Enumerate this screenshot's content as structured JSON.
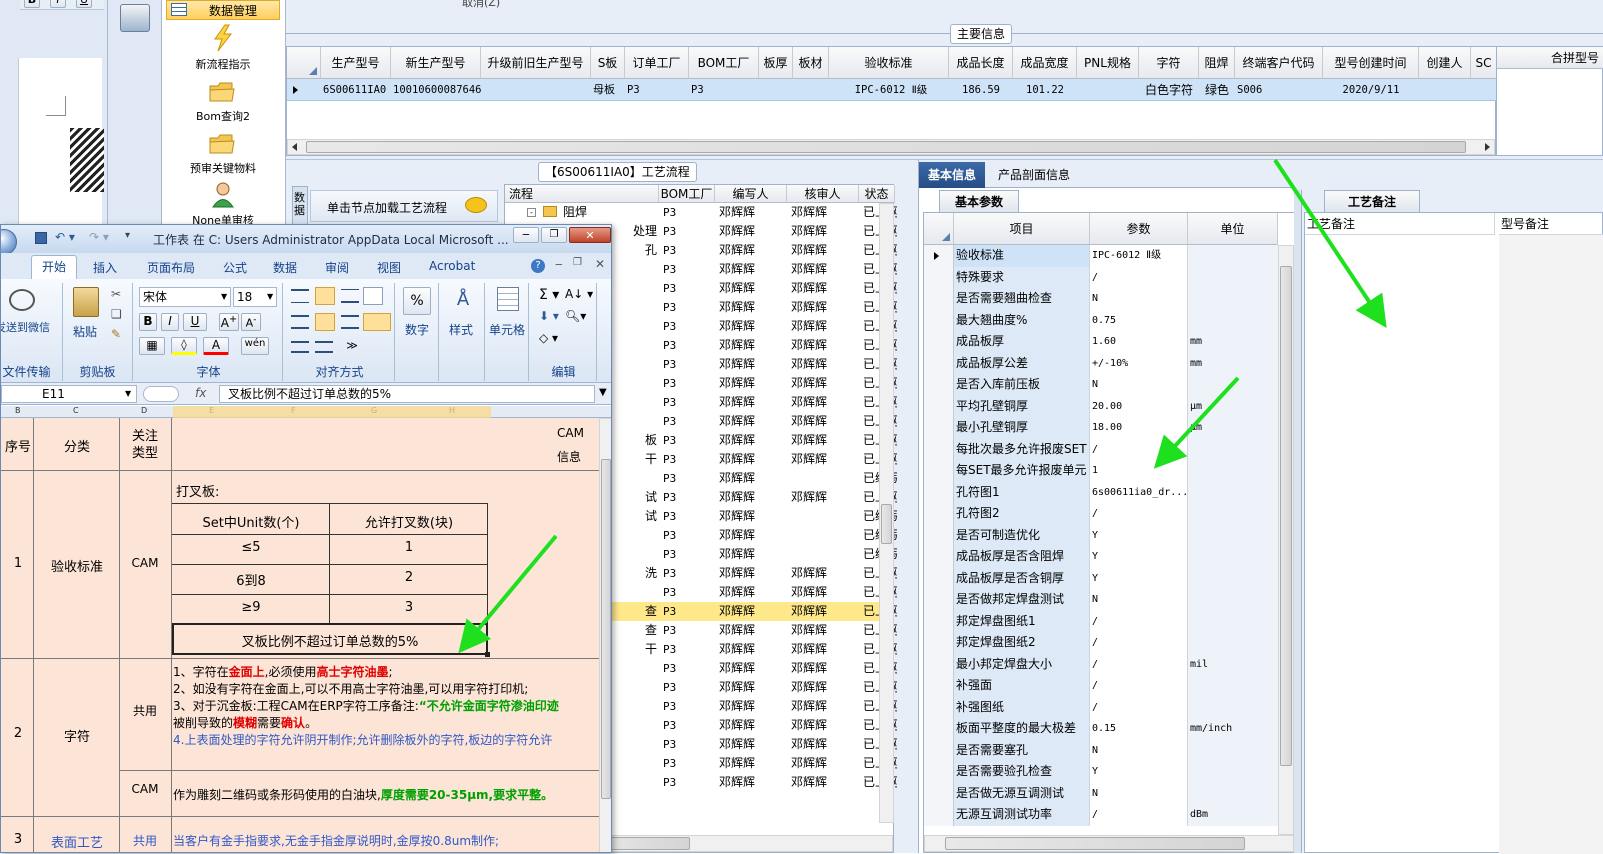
{
  "word_bg": {
    "fmt": [
      "B",
      "I",
      "U"
    ]
  },
  "launcher": {
    "items": [
      {
        "label": "数据管理",
        "icon": "table-icon"
      },
      {
        "label": "新流程指示",
        "icon": "lightning-icon"
      },
      {
        "label": "Bom查询2",
        "icon": "folder-icon"
      },
      {
        "label": "预审关键物料",
        "icon": "folder-icon"
      },
      {
        "label": "None单审核",
        "icon": "user-icon"
      }
    ]
  },
  "top_panel": {
    "cancel_label": "取消(Z)",
    "section_title": "主要信息",
    "merge_label": "合拼型号",
    "columns": [
      "生产型号",
      "新生产型号",
      "升级前旧生产型号",
      "S板",
      "订单工厂",
      "BOM工厂",
      "板厚",
      "板材",
      "验收标准",
      "成品长度",
      "成品宽度",
      "PNL规格",
      "字符",
      "阻焊",
      "终端客户代码",
      "型号创建时间",
      "创建人",
      "SC"
    ],
    "row": [
      "6S00611IA0",
      "10010600087646",
      "",
      "母板",
      "P3",
      "P3",
      "",
      "",
      "IPC-6012 Ⅱ级",
      "186.59",
      "101.22",
      "",
      "白色字符",
      "绿色",
      "S006",
      "2020/9/11",
      "",
      ""
    ]
  },
  "flow": {
    "title": "【6S00611IA0】工艺流程",
    "hint": "单击节点加载工艺流程",
    "side_tab": "数据",
    "columns": [
      "流程",
      "BOM工厂",
      "编写人",
      "核审人",
      "状态"
    ],
    "rows": [
      {
        "name": "阻焊",
        "tree": true,
        "bom": "P3",
        "w": "邓辉辉",
        "r": "邓辉辉",
        "s": "已上网"
      },
      {
        "name": "处理",
        "bom": "P3",
        "w": "邓辉辉",
        "r": "邓辉辉",
        "s": "已上网"
      },
      {
        "name": "孔",
        "bom": "P3",
        "w": "邓辉辉",
        "r": "邓辉辉",
        "s": "已上网"
      },
      {
        "name": "",
        "bom": "P3",
        "w": "邓辉辉",
        "r": "邓辉辉",
        "s": "已上网"
      },
      {
        "name": "",
        "bom": "P3",
        "w": "邓辉辉",
        "r": "邓辉辉",
        "s": "已上网"
      },
      {
        "name": "",
        "bom": "P3",
        "w": "邓辉辉",
        "r": "邓辉辉",
        "s": "已上网"
      },
      {
        "name": "",
        "bom": "P3",
        "w": "邓辉辉",
        "r": "邓辉辉",
        "s": "已上网"
      },
      {
        "name": "",
        "bom": "P3",
        "w": "邓辉辉",
        "r": "邓辉辉",
        "s": "已上网"
      },
      {
        "name": "",
        "bom": "P3",
        "w": "邓辉辉",
        "r": "邓辉辉",
        "s": "已上网"
      },
      {
        "name": "",
        "bom": "P3",
        "w": "邓辉辉",
        "r": "邓辉辉",
        "s": "已上网"
      },
      {
        "name": "",
        "bom": "P3",
        "w": "邓辉辉",
        "r": "邓辉辉",
        "s": "已上网"
      },
      {
        "name": "",
        "bom": "P3",
        "w": "邓辉辉",
        "r": "邓辉辉",
        "s": "已上网"
      },
      {
        "name": "板",
        "bom": "P3",
        "w": "邓辉辉",
        "r": "邓辉辉",
        "s": "已上网"
      },
      {
        "name": "干",
        "bom": "P3",
        "w": "邓辉辉",
        "r": "邓辉辉",
        "s": "已上网"
      },
      {
        "name": "",
        "bom": "P3",
        "w": "邓辉辉",
        "r": "",
        "s": "已编写"
      },
      {
        "name": "试",
        "bom": "P3",
        "w": "邓辉辉",
        "r": "邓辉辉",
        "s": "已上网"
      },
      {
        "name": "试",
        "bom": "P3",
        "w": "邓辉辉",
        "r": "",
        "s": "已编写"
      },
      {
        "name": "",
        "bom": "P3",
        "w": "邓辉辉",
        "r": "",
        "s": "已编写"
      },
      {
        "name": "",
        "bom": "P3",
        "w": "邓辉辉",
        "r": "",
        "s": "已编写"
      },
      {
        "name": "洗",
        "bom": "P3",
        "w": "邓辉辉",
        "r": "邓辉辉",
        "s": "已上网"
      },
      {
        "name": "",
        "bom": "P3",
        "w": "邓辉辉",
        "r": "邓辉辉",
        "s": "已上网"
      },
      {
        "name": "查",
        "bom": "P3",
        "w": "邓辉辉",
        "r": "邓辉辉",
        "s": "已上网",
        "hl": true
      },
      {
        "name": "查",
        "bom": "P3",
        "w": "邓辉辉",
        "r": "邓辉辉",
        "s": "已上网"
      },
      {
        "name": "干",
        "bom": "P3",
        "w": "邓辉辉",
        "r": "邓辉辉",
        "s": "已上网"
      },
      {
        "name": "",
        "bom": "P3",
        "w": "邓辉辉",
        "r": "邓辉辉",
        "s": "已上网"
      },
      {
        "name": "",
        "bom": "P3",
        "w": "邓辉辉",
        "r": "邓辉辉",
        "s": "已上网"
      },
      {
        "name": "",
        "bom": "P3",
        "w": "邓辉辉",
        "r": "邓辉辉",
        "s": "已上网"
      },
      {
        "name": "",
        "bom": "P3",
        "w": "邓辉辉",
        "r": "邓辉辉",
        "s": "已上网"
      },
      {
        "name": "",
        "bom": "P3",
        "w": "邓辉辉",
        "r": "邓辉辉",
        "s": "已上网"
      },
      {
        "name": "",
        "bom": "P3",
        "w": "邓辉辉",
        "r": "邓辉辉",
        "s": "已上网"
      },
      {
        "name": "",
        "bom": "P3",
        "w": "邓辉辉",
        "r": "邓辉辉",
        "s": "已上网"
      }
    ]
  },
  "props": {
    "tabs": [
      "基本信息",
      "产品剖面信息"
    ],
    "subtab": "基本参数",
    "columns": [
      "项目",
      "参数",
      "单位"
    ],
    "rows": [
      {
        "k": "验收标准",
        "v": "IPC-6012 Ⅱ级",
        "u": ""
      },
      {
        "k": "特殊要求",
        "v": "/",
        "u": ""
      },
      {
        "k": "是否需要翘曲检查",
        "v": "N",
        "u": ""
      },
      {
        "k": "最大翘曲度%",
        "v": "0.75",
        "u": ""
      },
      {
        "k": "成品板厚",
        "v": "1.60",
        "u": "mm"
      },
      {
        "k": "成品板厚公差",
        "v": "+/-10%",
        "u": "mm"
      },
      {
        "k": "是否入库前压板",
        "v": "N",
        "u": ""
      },
      {
        "k": "平均孔壁铜厚",
        "v": "20.00",
        "u": "μm"
      },
      {
        "k": "最小孔壁铜厚",
        "v": "18.00",
        "u": "μm"
      },
      {
        "k": "每批次最多允许报废SET",
        "v": "/",
        "u": ""
      },
      {
        "k": "每SET最多允许报废单元",
        "v": "1",
        "u": ""
      },
      {
        "k": "孔符图1",
        "v": "6s00611ia0_dr...",
        "u": ""
      },
      {
        "k": "孔符图2",
        "v": "/",
        "u": ""
      },
      {
        "k": "是否可制造优化",
        "v": "Y",
        "u": ""
      },
      {
        "k": "成品板厚是否含阻焊",
        "v": "Y",
        "u": ""
      },
      {
        "k": "成品板厚是否含铜厚",
        "v": "Y",
        "u": ""
      },
      {
        "k": "是否做邦定焊盘测试",
        "v": "N",
        "u": ""
      },
      {
        "k": "邦定焊盘图纸1",
        "v": "/",
        "u": ""
      },
      {
        "k": "邦定焊盘图纸2",
        "v": "/",
        "u": ""
      },
      {
        "k": "最小邦定焊盘大小",
        "v": "/",
        "u": "mil"
      },
      {
        "k": "补强面",
        "v": "/",
        "u": ""
      },
      {
        "k": "补强图纸",
        "v": "/",
        "u": ""
      },
      {
        "k": "板面平整度的最大极差",
        "v": "0.15",
        "u": "mm/inch"
      },
      {
        "k": "是否需要塞孔",
        "v": "N",
        "u": ""
      },
      {
        "k": "是否需要验孔检查",
        "v": "Y",
        "u": ""
      },
      {
        "k": "是否做无源互调测试",
        "v": "N",
        "u": ""
      },
      {
        "k": "无源互调测试功率",
        "v": "/",
        "u": "dBm"
      }
    ]
  },
  "remarks": {
    "tab": "工艺备注",
    "col1": "工艺备注",
    "col2": "型号备注"
  },
  "excel": {
    "title": "工作表 在 C: Users Administrator AppData Local Microsoft ...",
    "tabs": [
      "开始",
      "插入",
      "页面布局",
      "公式",
      "数据",
      "审阅",
      "视图",
      "Acrobat"
    ],
    "send_wechat": "发送到微信",
    "paste": "粘贴",
    "font_name": "宋体",
    "font_size": "18",
    "number": "数字",
    "style": "样式",
    "cells": "单元格",
    "groups": [
      "文件传输",
      "剪贴板",
      "字体",
      "对齐方式",
      "编辑"
    ],
    "cellref": "E11",
    "fx": "fx",
    "formula": "叉板比例不超过订单总数的5%",
    "col_letters": [
      "B",
      "C",
      "D",
      "E",
      "F",
      "G",
      "H"
    ],
    "head": {
      "no": "序号",
      "cat": "分类",
      "type": "关注类型",
      "cam": "CAM",
      "info": "信息"
    },
    "r1": {
      "no": "1",
      "cat": "验收标准",
      "type": "CAM",
      "title": "打叉板:",
      "t_h1": "Set中Unit数(个)",
      "t_h2": "允许打叉数(块)",
      "t_rows": [
        [
          "≤5",
          "1"
        ],
        [
          "6到8",
          "2"
        ],
        [
          "≥9",
          "3"
        ]
      ],
      "note": "叉板比例不超过订单总数的5%"
    },
    "r2": {
      "no": "2",
      "cat": "字符",
      "type1": "共用",
      "type2": "CAM",
      "l1a": "1、字符在",
      "l1b": "金面上",
      "l1c": ",必须使用",
      "l1d": "高士字符油墨",
      "l1e": ";",
      "l2": "2、如没有字符在金面上,可以不用高士字符油墨,可以用字符打印机;",
      "l3a": "3、对于沉金板:工程CAM在ERP字符工序备注:",
      "l3b": "“不允许金面字符渗油印迹",
      "l3c": "被削导致的",
      "l3d": "模糊",
      "l3e": "需要",
      "l3f": "确认",
      "l3g": "。",
      "l4": "4.上表面处理的字符允许阴开制作;允许删除板外的字符,板边的字符允许",
      "cam_a": "作为雕刻二维码或条形码使用的白油块,",
      "cam_b": "厚度需要20-35μm,要求平整。"
    },
    "r3": {
      "no": "3",
      "cat": "表面工艺",
      "type": "共用",
      "text": "当客户有金手指要求,无金手指金厚说明时,金厚按0.8um制作;"
    }
  }
}
